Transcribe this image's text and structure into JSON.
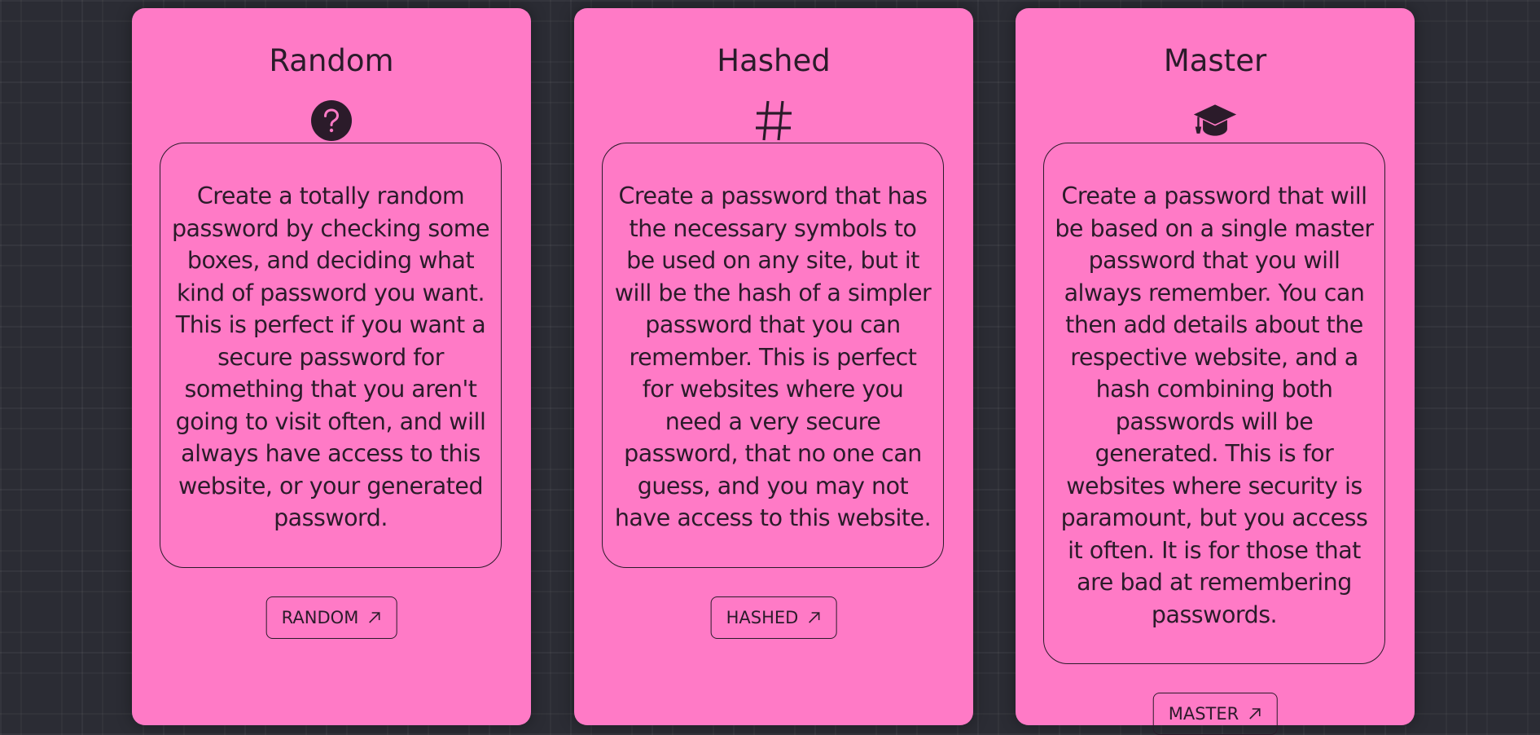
{
  "background": "#2b2c34",
  "card_color": "#ff7ac6",
  "text_color": "#2b1b2a",
  "cards": [
    {
      "title": "Random",
      "icon": "question-circle-icon",
      "description": "Create a totally random password by checking some boxes, and deciding what kind of password you want. This is perfect if you want a secure password for something that you aren't going to visit often, and will always have access to this website, or your generated password.",
      "button_label": "RANDOM",
      "button_icon": "arrow-up-right-icon"
    },
    {
      "title": "Hashed",
      "icon": "hash-icon",
      "description": "Create a password that has the necessary symbols to be used on any site, but it will be the hash of a simpler password that you can remember. This is perfect for websites where you need a very secure password, that no one can guess, and you may not have access to this website.",
      "button_label": "HASHED",
      "button_icon": "arrow-up-right-icon"
    },
    {
      "title": "Master",
      "icon": "graduation-cap-icon",
      "description": "Create a password that will be based on a single master password that you will always remember. You can then add details about the respective website, and a hash combining both passwords will be generated. This is for websites where security is paramount, but you access it often. It is for those that are bad at remembering passwords.",
      "button_label": "MASTER",
      "button_icon": "arrow-up-right-icon"
    }
  ]
}
